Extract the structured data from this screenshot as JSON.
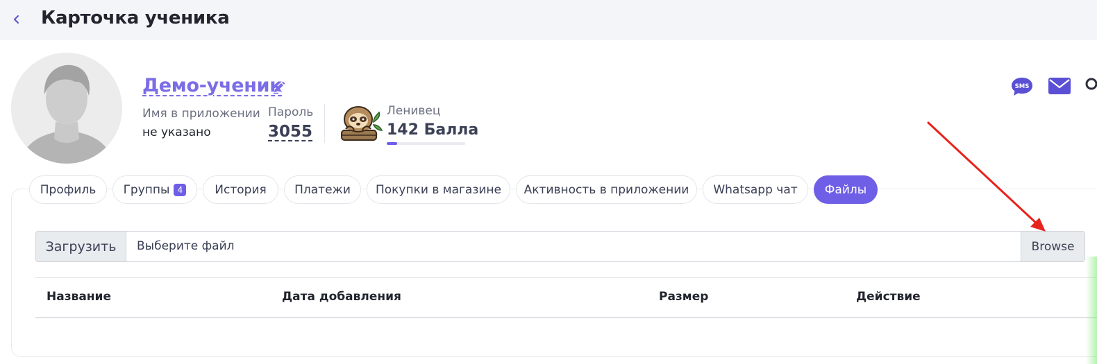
{
  "header": {
    "title": "Карточка ученика"
  },
  "student": {
    "name": "Демо-ученик",
    "app_name_label": "Имя в приложении",
    "app_name_value": "не указано",
    "password_label": "Пароль",
    "password_value": "3055",
    "level_name": "Ленивец",
    "points": "142 Балла",
    "level_progress_fraction": 0.13
  },
  "contacts": {
    "sms_icon": "sms-icon",
    "mail_icon": "mail-icon",
    "sms_text": "SMS"
  },
  "tabs": [
    {
      "label": "Профиль"
    },
    {
      "label": "Группы",
      "badge": "4"
    },
    {
      "label": "История"
    },
    {
      "label": "Платежи"
    },
    {
      "label": "Покупки в магазине"
    },
    {
      "label": "Активность в приложении"
    },
    {
      "label": "Whatsapp чат"
    },
    {
      "label": "Файлы",
      "active": true
    }
  ],
  "files": {
    "upload_label": "Загрузить",
    "file_placeholder": "Выберите файл",
    "browse_label": "Browse",
    "columns": [
      "Название",
      "Дата добавления",
      "Размер",
      "Действие"
    ],
    "rows": []
  },
  "colors": {
    "accent": "#6f5ee6",
    "arrow": "#e8231c",
    "topbar_bg": "#f4f5f8"
  }
}
